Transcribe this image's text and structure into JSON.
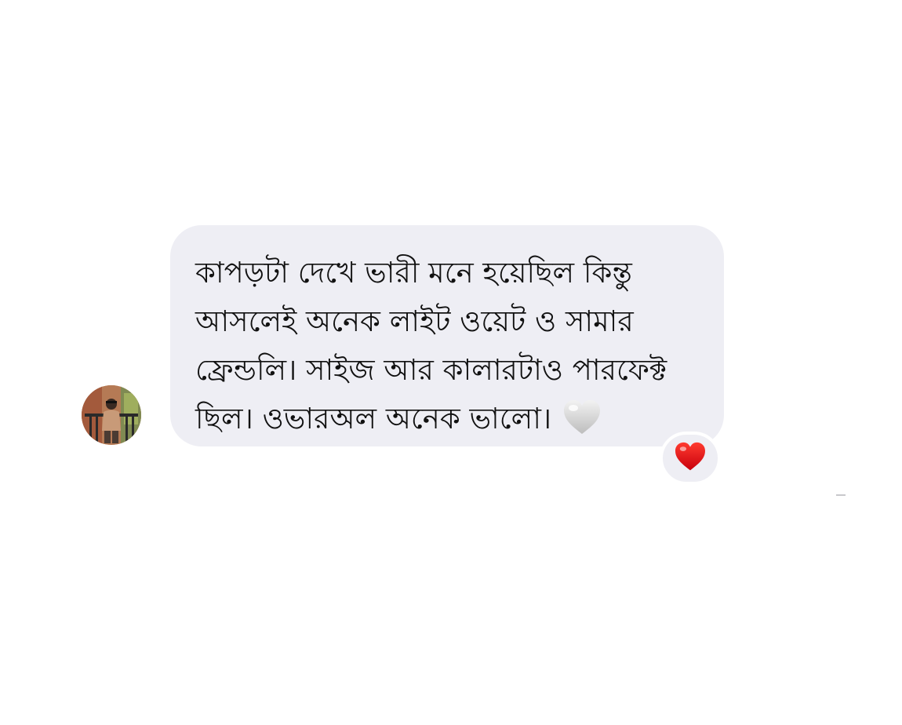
{
  "message": {
    "lines": [
      "কাপড়টা দেখে ভারী মনে হয়েছিল কিন্তু",
      "আসলেই অনেক লাইট ওয়েট ও সামার",
      "ফ্রেন্ডলি। সাইজ আর কালারটাও পারফেক্ট",
      "ছিল। ওভারঅল অনেক ভালো।"
    ],
    "inline_icon": "white-heart-icon"
  },
  "reaction": {
    "icon": "red-heart-icon"
  },
  "colors": {
    "bubble": "#eeeef4",
    "text": "#111111",
    "heart_red": "#e0141e",
    "heart_white": "#d9d9d9"
  }
}
